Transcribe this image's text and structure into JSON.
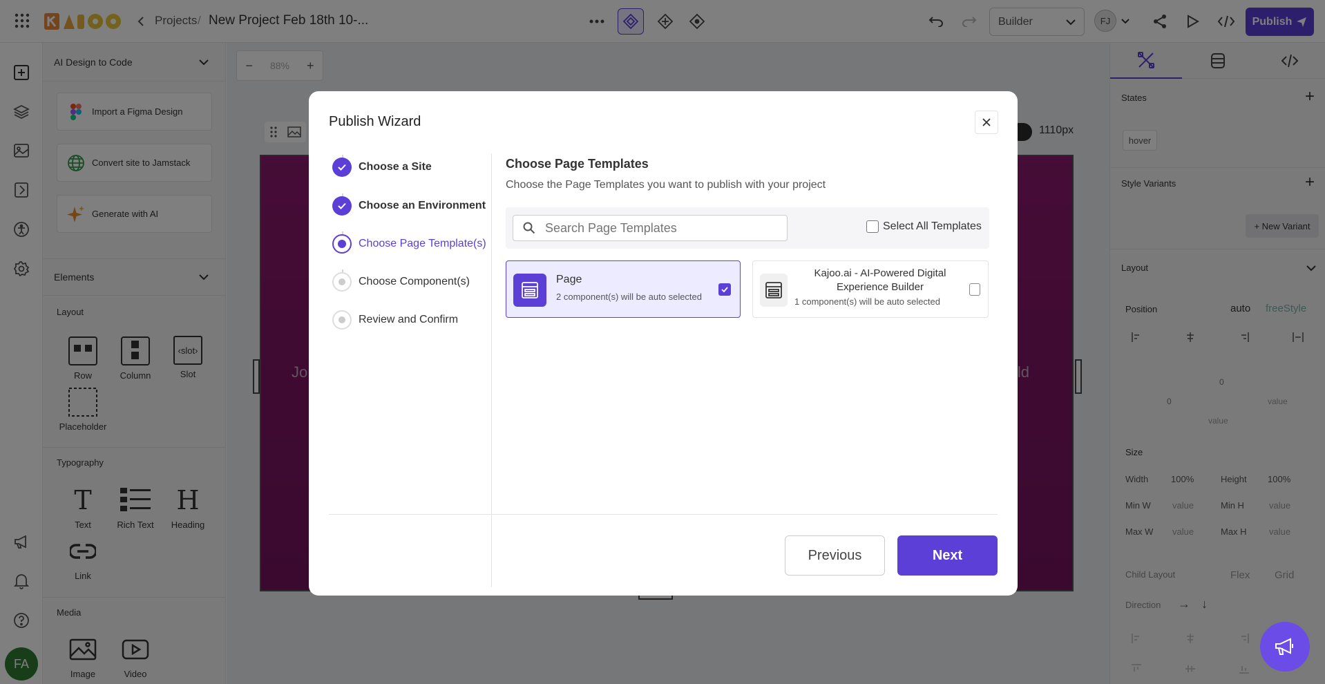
{
  "topbar": {
    "breadcrumb_projects": "Projects",
    "breadcrumb_sep": "/",
    "project_name": "New Project Feb 18th 10-...",
    "mode_select": "Builder",
    "user_initials": "FJ",
    "publish_label": "Publish"
  },
  "left_panel": {
    "ai_section_title": "AI Design to Code",
    "ai_cards": [
      {
        "label": "Import a Figma Design"
      },
      {
        "label": "Convert site to Jamstack"
      },
      {
        "label": "Generate with AI"
      }
    ],
    "elements_title": "Elements",
    "layout_title": "Layout",
    "layout_items": [
      "Row",
      "Column",
      "Slot",
      "Placeholder"
    ],
    "slot_glyph": "‹slot›",
    "typography_title": "Typography",
    "typography_items": [
      "Text",
      "Rich Text",
      "Heading",
      "Link"
    ],
    "media_title": "Media",
    "media_items": [
      "Image",
      "Video"
    ]
  },
  "rail": {
    "user_avatar": "FA"
  },
  "canvas": {
    "zoom": "88%",
    "zoom_minus": "−",
    "zoom_plus": "+",
    "width_readout": "1110px",
    "bg_text_left": "Jo",
    "bg_text_right": "ild"
  },
  "right_panel": {
    "states_title": "States",
    "state_chip": "hover",
    "style_variants_title": "Style Variants",
    "new_variant": "+ New Variant",
    "layout_title": "Layout",
    "position_label": "Position",
    "position_auto": "auto",
    "position_freestyle": "freeStyle",
    "pos_top": "0",
    "pos_left": "0",
    "pos_right": "value",
    "pos_bottom": "value",
    "size_title": "Size",
    "size_rows": [
      {
        "l1": "Width",
        "v1": "100%",
        "l2": "Height",
        "v2": "100%"
      },
      {
        "l1": "Min W",
        "v1": "value",
        "l2": "Min H",
        "v2": "value"
      },
      {
        "l1": "Max W",
        "v1": "value",
        "l2": "Max H",
        "v2": "value"
      }
    ],
    "child_layout": "Child Layout",
    "flex": "Flex",
    "grid": "Grid",
    "direction": "Direction",
    "arrow_right": "→",
    "arrow_down": "↓"
  },
  "modal": {
    "title": "Publish Wizard",
    "steps": [
      {
        "label": "Choose a Site",
        "state": "done"
      },
      {
        "label": "Choose an Environment",
        "state": "done"
      },
      {
        "label": "Choose Page Template(s)",
        "state": "active"
      },
      {
        "label": "Choose Component(s)",
        "state": "pending"
      },
      {
        "label": "Review and Confirm",
        "state": "pending"
      }
    ],
    "section_title": "Choose Page Templates",
    "section_subtitle": "Choose the Page Templates you want to publish with your project",
    "search_placeholder": "Search Page Templates",
    "select_all_label": "Select All Templates",
    "templates": [
      {
        "name": "Page",
        "sub": "2 component(s) will be auto selected",
        "selected": true
      },
      {
        "name": "Kajoo.ai - AI-Powered Digital Experience Builder",
        "sub": "1 component(s) will be auto selected",
        "selected": false
      }
    ],
    "previous_label": "Previous",
    "next_label": "Next"
  },
  "colors": {
    "accent": "#5b3fd6",
    "canvas_magenta": "#8a1a6e",
    "fab": "#6b4ce6",
    "avatar": "#2e7d32"
  }
}
